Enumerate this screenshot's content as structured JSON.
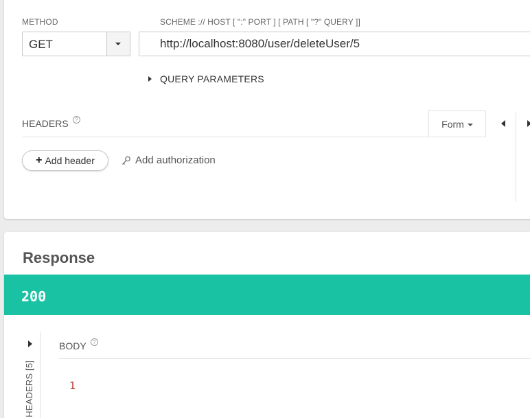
{
  "request": {
    "method_label": "METHOD",
    "method_value": "GET",
    "url_label": "SCHEME :// HOST [ \":\" PORT ] [ PATH [ \"?\" QUERY ]]",
    "url_value": "http://localhost:8080/user/deleteUser/5",
    "query_params_label": "QUERY PARAMETERS",
    "headers_label": "HEADERS",
    "help_glyph": "?",
    "form_label": "Form",
    "add_header_label": "Add header",
    "add_header_glyph": "+",
    "add_authorization_label": "Add authorization"
  },
  "response": {
    "title": "Response",
    "status_code": "200",
    "status_color": "#1ac2a4",
    "headers_tab_label": "HEADERS [5]",
    "body_label": "BODY",
    "help_glyph": "?",
    "body_content": "1"
  }
}
